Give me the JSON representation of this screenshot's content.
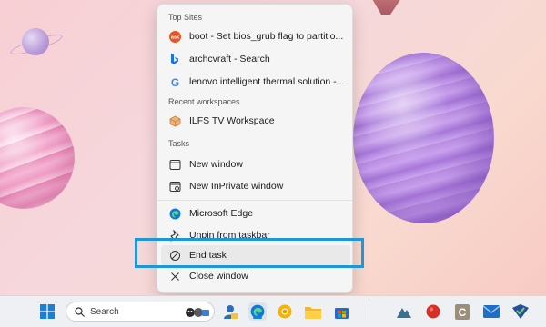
{
  "jumplist": {
    "sections": {
      "top_sites": "Top Sites",
      "recent_workspaces": "Recent workspaces",
      "tasks": "Tasks"
    },
    "top_sites": [
      {
        "label": "boot - Set bios_grub flag to partitio...",
        "icon": "askubuntu-icon"
      },
      {
        "label": "archcvraft - Search",
        "icon": "bing-icon"
      },
      {
        "label": "lenovo intelligent thermal solution -...",
        "icon": "google-icon"
      }
    ],
    "workspaces": [
      {
        "label": "ILFS TV Workspace",
        "icon": "workspace-icon"
      }
    ],
    "tasks": [
      {
        "label": "New window",
        "icon": "new-window-icon"
      },
      {
        "label": "New InPrivate window",
        "icon": "inprivate-window-icon"
      }
    ],
    "app": [
      {
        "label": "Microsoft Edge",
        "icon": "edge-icon"
      },
      {
        "label": "Unpin from taskbar",
        "icon": "unpin-icon"
      },
      {
        "label": "End task",
        "icon": "end-task-icon"
      },
      {
        "label": "Close window",
        "icon": "close-icon"
      }
    ]
  },
  "taskbar": {
    "search_placeholder": "Search"
  },
  "colors": {
    "highlight": "#1e96d8",
    "edge": "#0c7bd6",
    "accent_red": "#d93025"
  }
}
